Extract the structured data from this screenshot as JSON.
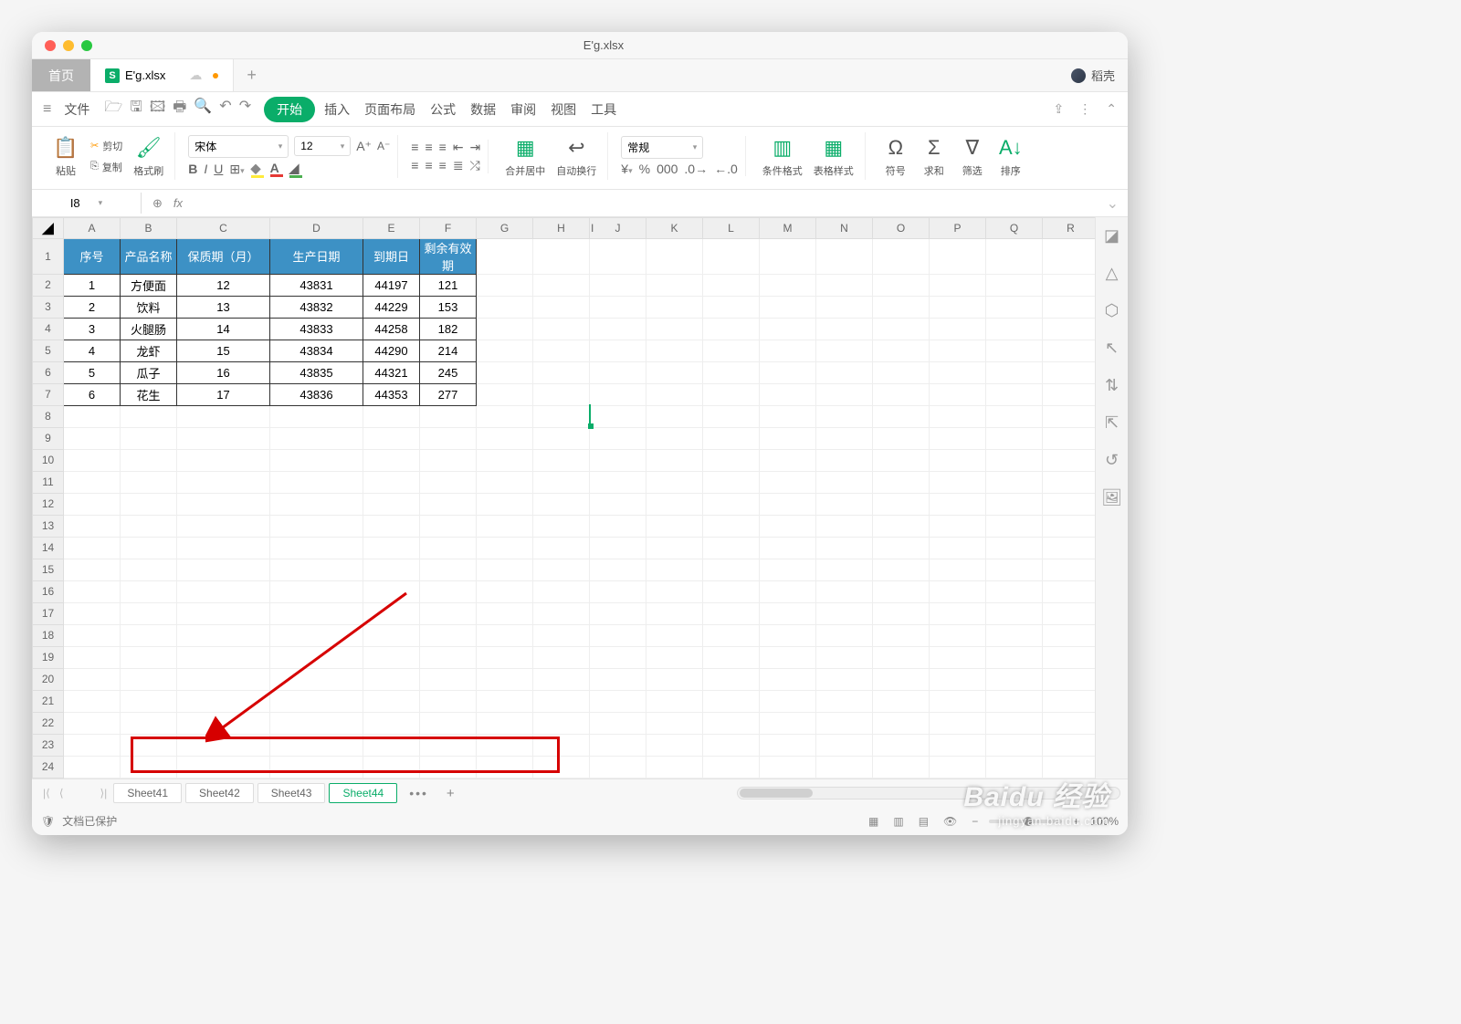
{
  "window": {
    "title": "E'g.xlsx"
  },
  "tabs": {
    "home": "首页",
    "file_name": "E'g.xlsx",
    "user": "稻壳"
  },
  "menu": {
    "file": "文件",
    "items": [
      "开始",
      "插入",
      "页面布局",
      "公式",
      "数据",
      "审阅",
      "视图",
      "工具"
    ]
  },
  "ribbon": {
    "paste": "粘贴",
    "cut": "剪切",
    "copy": "复制",
    "format_painter": "格式刷",
    "font_name": "宋体",
    "font_size": "12",
    "merge": "合并居中",
    "wrap": "自动换行",
    "num_format": "常规",
    "cond_fmt": "条件格式",
    "table_style": "表格样式",
    "symbol": "符号",
    "sum": "求和",
    "filter": "筛选",
    "sort": "排序"
  },
  "namebox": "I8",
  "columns": [
    "A",
    "B",
    "C",
    "D",
    "E",
    "F",
    "G",
    "H",
    "I",
    "J",
    "K",
    "L",
    "M",
    "N",
    "O",
    "P",
    "Q",
    "R"
  ],
  "headers": [
    "序号",
    "产品名称",
    "保质期（月）",
    "生产日期",
    "到期日",
    "剩余有效期"
  ],
  "rows": [
    [
      "1",
      "方便面",
      "12",
      "43831",
      "44197",
      "121"
    ],
    [
      "2",
      "饮料",
      "13",
      "43832",
      "44229",
      "153"
    ],
    [
      "3",
      "火腿肠",
      "14",
      "43833",
      "44258",
      "182"
    ],
    [
      "4",
      "龙虾",
      "15",
      "43834",
      "44290",
      "214"
    ],
    [
      "5",
      "瓜子",
      "16",
      "43835",
      "44321",
      "245"
    ],
    [
      "6",
      "花生",
      "17",
      "43836",
      "44353",
      "277"
    ]
  ],
  "sheets": [
    "Sheet41",
    "Sheet42",
    "Sheet43",
    "Sheet44"
  ],
  "status": {
    "protected": "文档已保护",
    "zoom": "100%"
  },
  "watermark": {
    "brand": "Baidu 经验",
    "url": "jingyan.baidu.com"
  }
}
